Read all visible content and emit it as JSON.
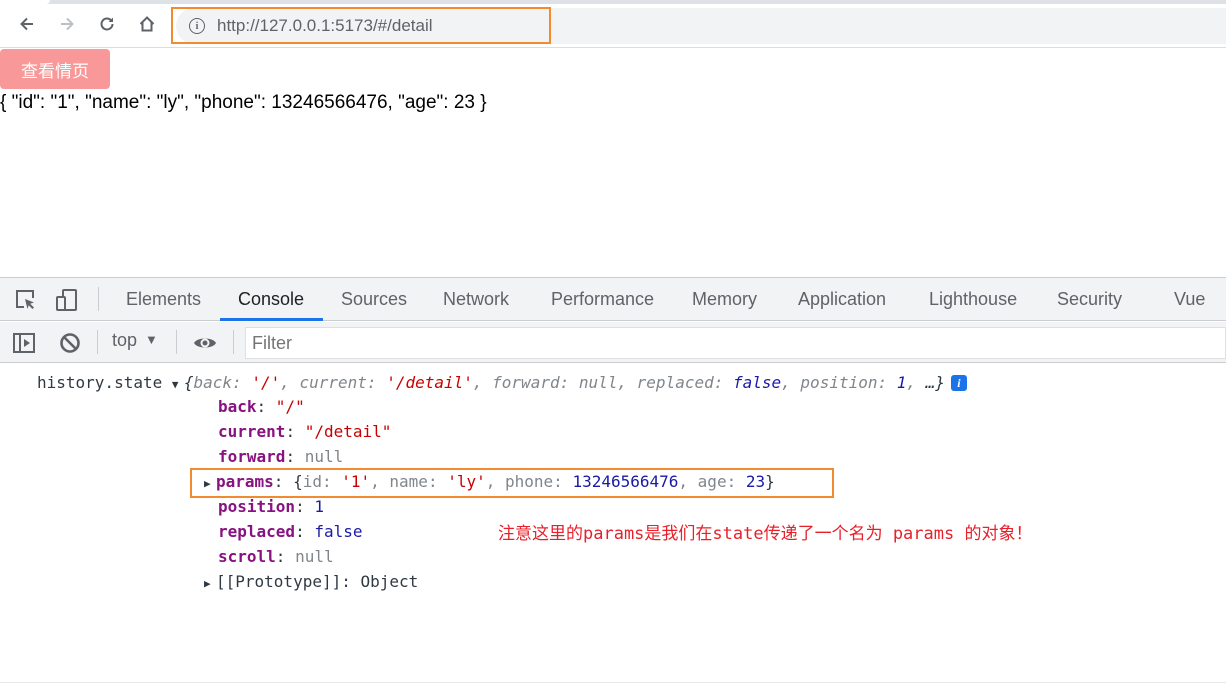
{
  "browser": {
    "url": "http://127.0.0.1:5173/#/detail",
    "back_icon": "arrow-left-icon",
    "forward_icon": "arrow-right-icon",
    "reload_icon": "reload-icon",
    "home_icon": "home-icon",
    "site_info_icon": "info-icon"
  },
  "page": {
    "view_button_label": "查看情页",
    "json_text": "{ \"id\": \"1\", \"name\": \"ly\", \"phone\": 13246566476, \"age\": 23 }"
  },
  "devtools": {
    "tabs": [
      {
        "label": "Elements",
        "active": false
      },
      {
        "label": "Console",
        "active": true
      },
      {
        "label": "Sources",
        "active": false
      },
      {
        "label": "Network",
        "active": false
      },
      {
        "label": "Performance",
        "active": false
      },
      {
        "label": "Memory",
        "active": false
      },
      {
        "label": "Application",
        "active": false
      },
      {
        "label": "Lighthouse",
        "active": false
      },
      {
        "label": "Security",
        "active": false
      },
      {
        "label": "Vue",
        "active": false
      }
    ],
    "context": "top",
    "filter_placeholder": "Filter",
    "colors": {
      "accent": "#1a73e8",
      "highlight_box": "#f28b30",
      "annotation": "#e8202a"
    }
  },
  "console": {
    "label": "history.state",
    "summary": {
      "open": "{",
      "back_key": "back",
      "back_val": "'/'",
      "current_key": "current",
      "current_val": "'/detail'",
      "forward_key": "forward",
      "forward_val": "null",
      "replaced_key": "replaced",
      "replaced_val": "false",
      "position_key": "position",
      "position_val": "1",
      "tail": "…}"
    },
    "props": {
      "back": {
        "key": "back",
        "value": "\"/\""
      },
      "current": {
        "key": "current",
        "value": "\"/detail\""
      },
      "forward": {
        "key": "forward",
        "value": "null"
      },
      "params": {
        "key": "params",
        "id_key": "id",
        "id_val": "'1'",
        "name_key": "name",
        "name_val": "'ly'",
        "phone_key": "phone",
        "phone_val": "13246566476",
        "age_key": "age",
        "age_val": "23"
      },
      "position": {
        "key": "position",
        "value": "1"
      },
      "replaced": {
        "key": "replaced",
        "value": "false"
      },
      "scroll": {
        "key": "scroll",
        "value": "null"
      },
      "prototype": {
        "key": "[[Prototype]]",
        "value": "Object"
      }
    }
  },
  "annotation": "注意这里的params是我们在state传递了一个名为 params 的对象！"
}
